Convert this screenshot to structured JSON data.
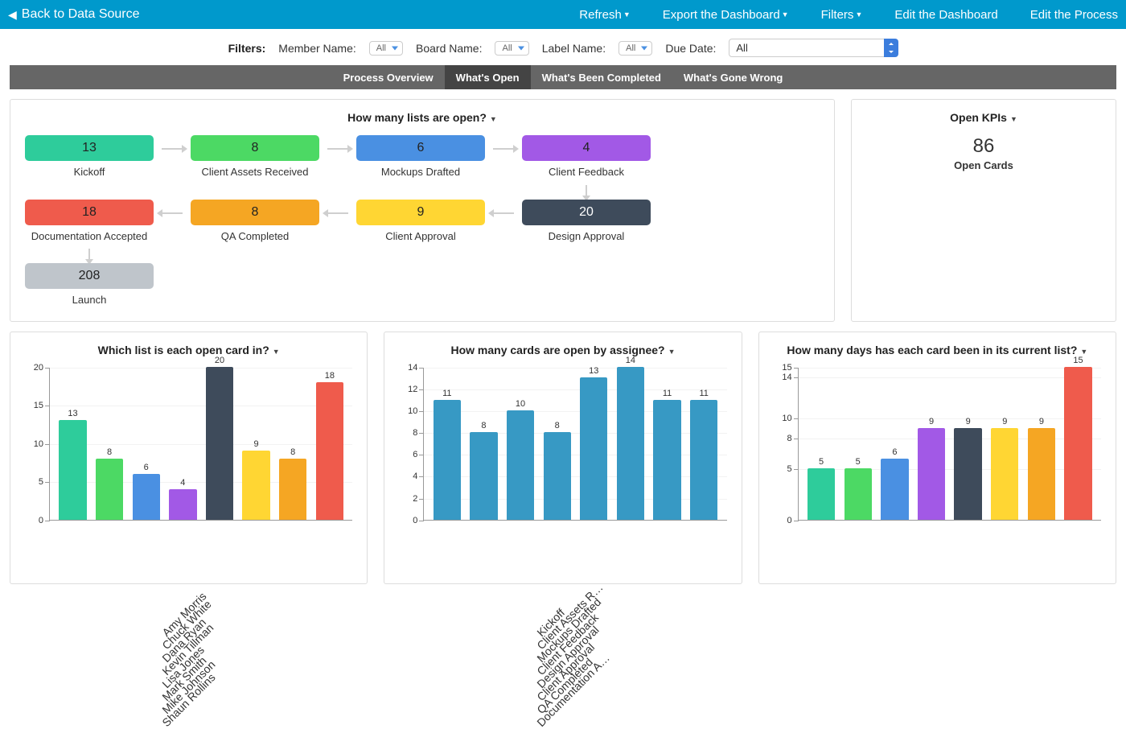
{
  "topbar": {
    "back": "Back to Data Source",
    "refresh": "Refresh",
    "export": "Export the Dashboard",
    "filters": "Filters",
    "edit_dash": "Edit the Dashboard",
    "edit_process": "Edit the Process"
  },
  "filters": {
    "title": "Filters:",
    "member": "Member Name:",
    "board": "Board Name:",
    "label": "Label Name:",
    "due": "Due Date:",
    "all": "All"
  },
  "tabs": {
    "overview": "Process Overview",
    "open": "What's Open",
    "completed": "What's Been Completed",
    "wrong": "What's Gone Wrong"
  },
  "flow": {
    "title": "How many lists are open?",
    "items": [
      {
        "label": "Kickoff",
        "value": 13,
        "color": "c-teal"
      },
      {
        "label": "Client Assets Received",
        "value": 8,
        "color": "c-green"
      },
      {
        "label": "Mockups Drafted",
        "value": 6,
        "color": "c-blue"
      },
      {
        "label": "Client Feedback",
        "value": 4,
        "color": "c-purple"
      },
      {
        "label": "Documentation Accepted",
        "value": 18,
        "color": "c-red"
      },
      {
        "label": "QA Completed",
        "value": 8,
        "color": "c-orange"
      },
      {
        "label": "Client Approval",
        "value": 9,
        "color": "c-yellow"
      },
      {
        "label": "Design Approval",
        "value": 20,
        "color": "c-slate"
      },
      {
        "label": "Launch",
        "value": 208,
        "color": "c-gray"
      }
    ]
  },
  "kpi": {
    "title": "Open KPIs",
    "value": 86,
    "label": "Open Cards"
  },
  "chart_data": [
    {
      "type": "bar",
      "title": "Which list is each open card in?",
      "ylim": [
        0,
        20
      ],
      "yticks": [
        0,
        5,
        10,
        15,
        20
      ],
      "categories": [
        "Kickoff",
        "Client Assets R…",
        "Mockups Drafted",
        "Client Feedback",
        "Design Approval",
        "Client Approval",
        "QA Completed",
        "Documentation A…"
      ],
      "values": [
        13,
        8,
        6,
        4,
        20,
        9,
        8,
        18
      ],
      "colors": [
        "c-teal",
        "c-green",
        "c-blue",
        "c-purple",
        "c-slate",
        "c-yellow",
        "c-orange",
        "c-red"
      ]
    },
    {
      "type": "bar",
      "title": "How many cards are open by assignee?",
      "ylim": [
        0,
        14
      ],
      "yticks": [
        0,
        2,
        4,
        6,
        8,
        10,
        12,
        14
      ],
      "categories": [
        "Amy Morris",
        "Chuck White",
        "Dana Ryan",
        "Kevin Tillman",
        "Lisa Jones",
        "Mark Smith",
        "Mike Johnson",
        "Shaun Rollins"
      ],
      "values": [
        11,
        8,
        10,
        8,
        13,
        14,
        11,
        11
      ],
      "colors": [
        "c-steel",
        "c-steel",
        "c-steel",
        "c-steel",
        "c-steel",
        "c-steel",
        "c-steel",
        "c-steel"
      ]
    },
    {
      "type": "bar",
      "title": "How many days has each card been in its current list?",
      "ylim": [
        0,
        15
      ],
      "yticks": [
        0,
        5,
        8,
        10,
        14,
        15
      ],
      "categories": [
        "Kickoff",
        "Client Assets R…",
        "Mockups Drafted",
        "Client Feedback",
        "Design Approval",
        "Client Approval",
        "QA Completed",
        "Documentation A…"
      ],
      "values": [
        5,
        5,
        6,
        9,
        9,
        9,
        9,
        15
      ],
      "colors": [
        "c-teal",
        "c-green",
        "c-blue",
        "c-purple",
        "c-slate",
        "c-yellow",
        "c-orange",
        "c-red"
      ]
    }
  ]
}
